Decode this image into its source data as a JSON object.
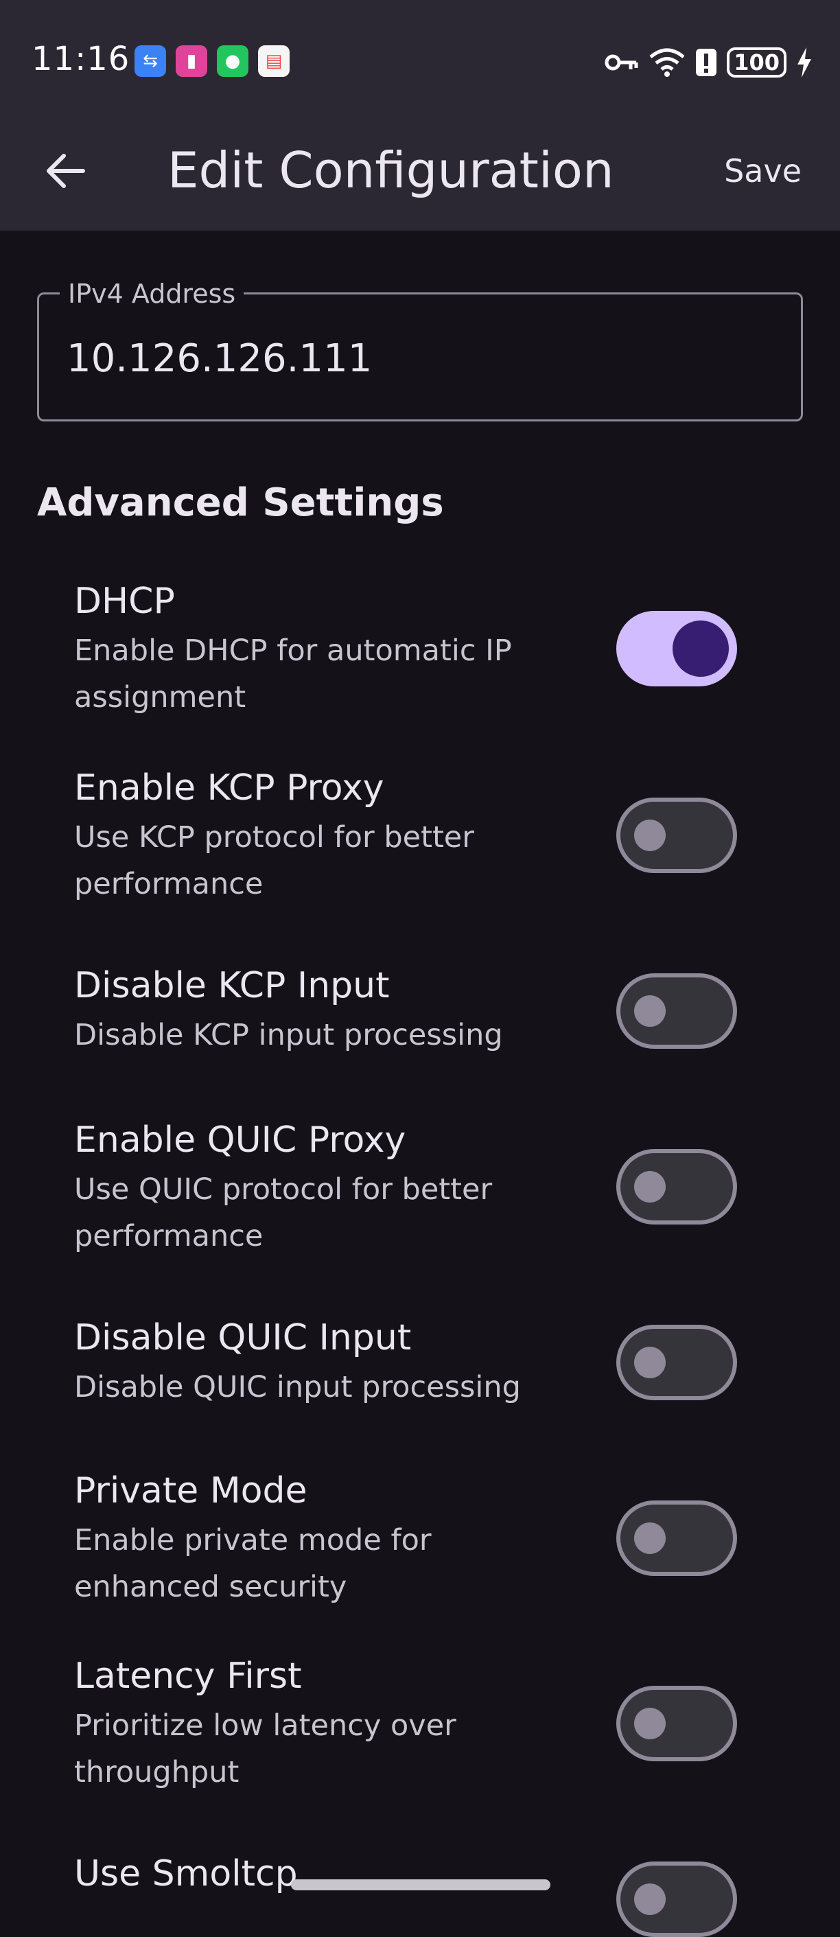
{
  "status_bar": {
    "time": "11:16",
    "notification_icons": [
      {
        "name": "usb-icon",
        "glyph": "⇆",
        "color": "#3b82f6"
      },
      {
        "name": "app-shortcut-icon",
        "glyph": "▮",
        "color": "#e0449a"
      },
      {
        "name": "wechat-icon",
        "glyph": "●",
        "color": "#22c55e"
      },
      {
        "name": "calendar-app-icon",
        "glyph": "▤",
        "color": "#ef4444"
      }
    ],
    "vpn_icon": "key-icon",
    "wifi_icon": "wifi-icon",
    "alert_icon": "alert-icon",
    "battery": "100",
    "charging_icon": "bolt-icon"
  },
  "app_bar": {
    "back_icon": "arrow-back-icon",
    "title": "Edit Configuration",
    "save_label": "Save"
  },
  "ipv4": {
    "label": "IPv4 Address",
    "value": "10.126.126.111"
  },
  "advanced": {
    "title": "Advanced Settings",
    "settings": [
      {
        "title": "DHCP",
        "desc": "Enable DHCP for automatic IP assignment",
        "enabled": true
      },
      {
        "title": "Enable KCP Proxy",
        "desc": "Use KCP protocol for better performance",
        "enabled": false
      },
      {
        "title": "Disable KCP Input",
        "desc": "Disable KCP input processing",
        "enabled": false
      },
      {
        "title": "Enable QUIC Proxy",
        "desc": "Use QUIC protocol for better performance",
        "enabled": false
      },
      {
        "title": "Disable QUIC Input",
        "desc": "Disable QUIC input processing",
        "enabled": false
      },
      {
        "title": "Private Mode",
        "desc": "Enable private mode for enhanced security",
        "enabled": false
      },
      {
        "title": "Latency First",
        "desc": "Prioritize low latency over throughput",
        "enabled": false
      },
      {
        "title": "Use Smoltcp",
        "desc": "",
        "enabled": false
      }
    ]
  },
  "colors": {
    "background": "#141118",
    "bar": "#2b2833",
    "accent": "#d0bcff",
    "accent_dark": "#381e72"
  }
}
